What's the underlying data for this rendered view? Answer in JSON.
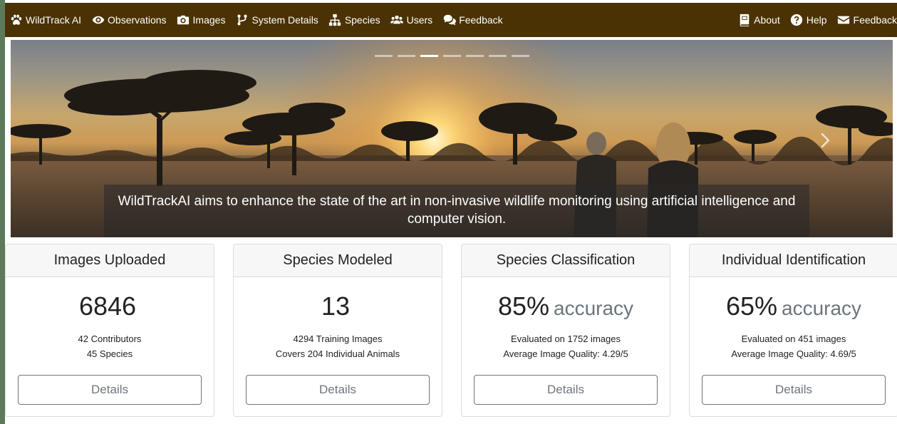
{
  "navbar": {
    "brand": {
      "label": "WildTrack AI",
      "icon": "paw-icon"
    },
    "left_items": [
      {
        "label": "Observations",
        "icon": "eye-icon"
      },
      {
        "label": "Images",
        "icon": "camera-icon"
      },
      {
        "label": "System Details",
        "icon": "branch-icon"
      },
      {
        "label": "Species",
        "icon": "sitemap-icon"
      },
      {
        "label": "Users",
        "icon": "users-icon"
      },
      {
        "label": "Feedback",
        "icon": "comments-icon"
      }
    ],
    "right_items": [
      {
        "label": "About",
        "icon": "book-icon"
      },
      {
        "label": "Help",
        "icon": "question-circle-icon"
      },
      {
        "label": "Feedback",
        "icon": "envelope-icon"
      }
    ],
    "background_color": "#4a3204"
  },
  "carousel": {
    "slide_count": 7,
    "active_index": 2,
    "caption": "WildTrackAI aims to enhance the state of the art in non-invasive wildlife monitoring using artificial intelligence and computer vision.",
    "next_icon": "chevron-right-icon"
  },
  "cards": [
    {
      "title": "Images Uploaded",
      "value": "6846",
      "value_suffix": "",
      "lines": [
        "42 Contributors",
        "45 Species"
      ],
      "button": "Details"
    },
    {
      "title": "Species Modeled",
      "value": "13",
      "value_suffix": "",
      "lines": [
        "4294 Training Images",
        "Covers 204 Individual Animals"
      ],
      "button": "Details"
    },
    {
      "title": "Species Classification",
      "value": "85%",
      "value_suffix": "accuracy",
      "lines": [
        "Evaluated on 1752 images",
        "Average Image Quality: 4.29/5"
      ],
      "button": "Details"
    },
    {
      "title": "Individual Identification",
      "value": "65%",
      "value_suffix": "accuracy",
      "lines": [
        "Evaluated on 451 images",
        "Average Image Quality: 4.69/5"
      ],
      "button": "Details"
    }
  ]
}
